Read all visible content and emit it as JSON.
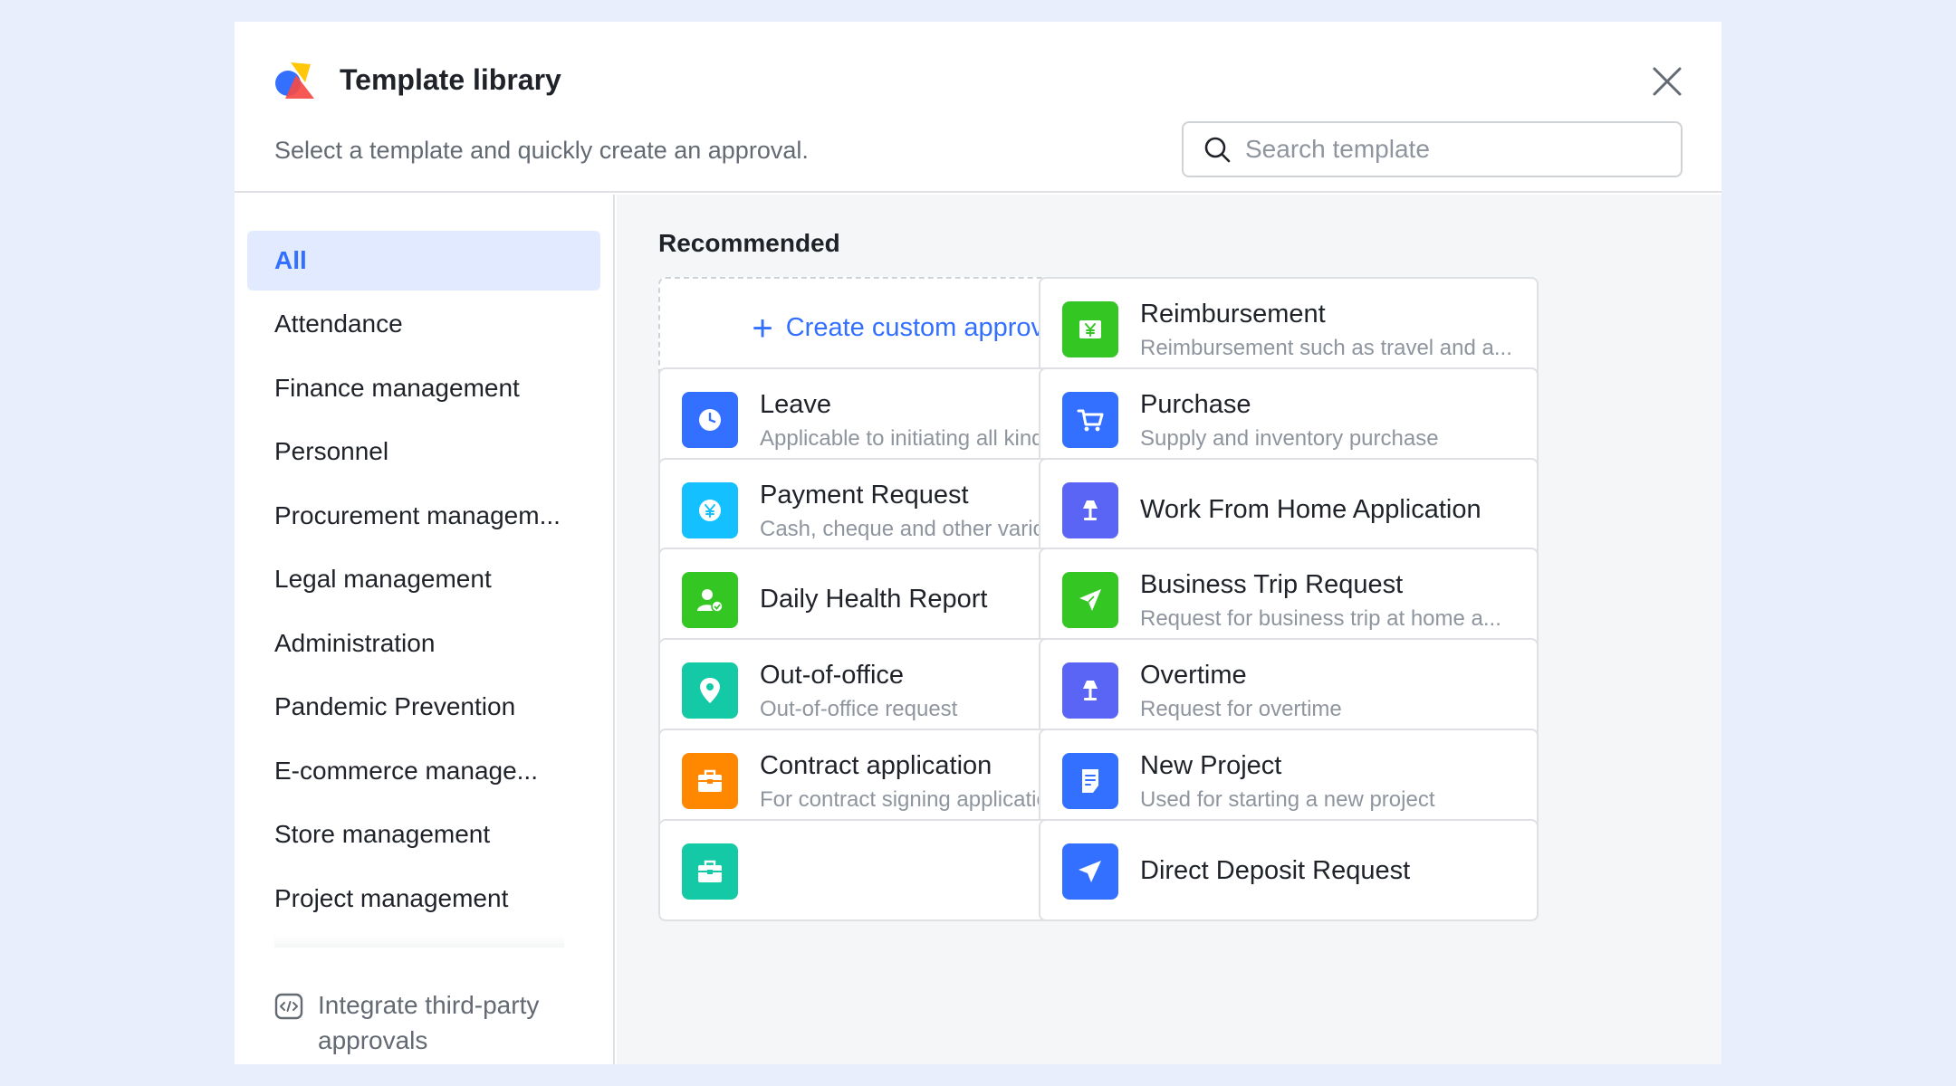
{
  "header": {
    "title": "Template library",
    "subtitle": "Select a template and quickly create an approval.",
    "search_placeholder": "Search template"
  },
  "sidebar": {
    "items": [
      {
        "label": "All",
        "active": true
      },
      {
        "label": "Attendance"
      },
      {
        "label": "Finance management"
      },
      {
        "label": "Personnel"
      },
      {
        "label": "Procurement managem..."
      },
      {
        "label": "Legal management"
      },
      {
        "label": "Administration"
      },
      {
        "label": "Pandemic Prevention"
      },
      {
        "label": "E-commerce manage..."
      },
      {
        "label": "Store management"
      },
      {
        "label": "Project management"
      }
    ],
    "integrate_label": "Integrate third-party approvals"
  },
  "main": {
    "section_title": "Recommended",
    "create_label": "Create custom approval",
    "templates": [
      {
        "name": "Reimbursement",
        "desc": "Reimbursement such as travel and a...",
        "color": "#34c724",
        "icon": "yen-bill-icon"
      },
      {
        "name": "Leave",
        "desc": "Applicable to initiating all kinds of le...",
        "color": "#3370ff",
        "icon": "clock-icon"
      },
      {
        "name": "Purchase",
        "desc": "Supply and inventory purchase",
        "color": "#3370ff",
        "icon": "cart-icon"
      },
      {
        "name": "Payment Request",
        "desc": "Cash, cheque and other various (cor...",
        "color": "#14c0ff",
        "icon": "yen-coin-icon"
      },
      {
        "name": "Work From Home Application",
        "desc": "",
        "color": "#5b65f5",
        "icon": "lamp-icon"
      },
      {
        "name": "Daily Health Report",
        "desc": "",
        "color": "#34c724",
        "icon": "person-check-icon"
      },
      {
        "name": "Business Trip Request",
        "desc": "Request for business trip at home a...",
        "color": "#34c724",
        "icon": "airplane-icon"
      },
      {
        "name": "Out-of-office",
        "desc": "Out-of-office request",
        "color": "#14c9a5",
        "icon": "location-pin-icon"
      },
      {
        "name": "Overtime",
        "desc": "Request for overtime",
        "color": "#5b65f5",
        "icon": "lamp-icon"
      },
      {
        "name": "Contract application",
        "desc": "For contract signing application",
        "color": "#ff8800",
        "icon": "briefcase-icon"
      },
      {
        "name": "New Project",
        "desc": "Used for starting a new project",
        "color": "#3370ff",
        "icon": "document-icon"
      },
      {
        "name": "",
        "desc": "",
        "color": "#14c9a5",
        "icon": "briefcase-icon"
      },
      {
        "name": "Direct Deposit Request",
        "desc": "",
        "color": "#3370ff",
        "icon": "send-icon"
      }
    ]
  }
}
